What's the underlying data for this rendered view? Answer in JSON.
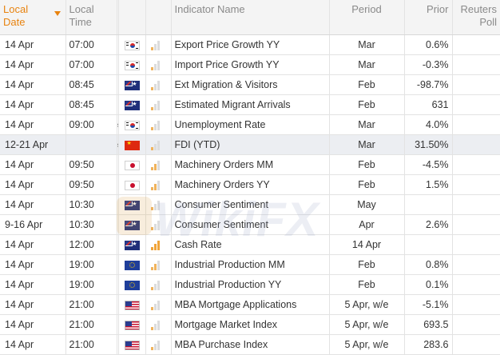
{
  "header": {
    "local_date": [
      "Local",
      "Date"
    ],
    "local_time": [
      "Local",
      "Time"
    ],
    "indicator_name": "Indicator Name",
    "period": "Period",
    "prior": "Prior",
    "reuters_poll": [
      "Reuters",
      "Poll"
    ]
  },
  "colors": {
    "sorted_header": "#e8830f",
    "importance_active": "#f0a43a",
    "highlight_row": "#eceef2"
  },
  "rows": [
    {
      "date": "14 Apr",
      "time": "07:00",
      "approx": "",
      "flag": "south-korea-flag",
      "importance": 1,
      "name": "Export Price Growth YY",
      "period": "Mar",
      "prior": "0.6%",
      "poll": "",
      "highlight": false
    },
    {
      "date": "14 Apr",
      "time": "07:00",
      "approx": "",
      "flag": "south-korea-flag",
      "importance": 1,
      "name": "Import Price Growth YY",
      "period": "Mar",
      "prior": "-0.3%",
      "poll": "",
      "highlight": false
    },
    {
      "date": "14 Apr",
      "time": "08:45",
      "approx": "",
      "flag": "new-zealand-flag",
      "importance": 1,
      "name": "Ext Migration & Visitors",
      "period": "Feb",
      "prior": "-98.7%",
      "poll": "",
      "highlight": false
    },
    {
      "date": "14 Apr",
      "time": "08:45",
      "approx": "",
      "flag": "new-zealand-flag",
      "importance": 1,
      "name": "Estimated Migrant Arrivals",
      "period": "Feb",
      "prior": "631",
      "poll": "",
      "highlight": false
    },
    {
      "date": "14 Apr",
      "time": "09:00",
      "approx": "≈",
      "flag": "south-korea-flag",
      "importance": 1,
      "name": "Unemployment Rate",
      "period": "Mar",
      "prior": "4.0%",
      "poll": "",
      "highlight": false
    },
    {
      "date": "12-21 Apr",
      "time": "",
      "approx": "≈",
      "flag": "china-flag",
      "importance": 1,
      "name": "FDI (YTD)",
      "period": "Mar",
      "prior": "31.50%",
      "poll": "",
      "highlight": true
    },
    {
      "date": "14 Apr",
      "time": "09:50",
      "approx": "",
      "flag": "japan-flag",
      "importance": 2,
      "name": "Machinery Orders MM",
      "period": "Feb",
      "prior": "-4.5%",
      "poll": "",
      "highlight": false
    },
    {
      "date": "14 Apr",
      "time": "09:50",
      "approx": "",
      "flag": "japan-flag",
      "importance": 2,
      "name": "Machinery Orders YY",
      "period": "Feb",
      "prior": "1.5%",
      "poll": "",
      "highlight": false
    },
    {
      "date": "14 Apr",
      "time": "10:30",
      "approx": "",
      "flag": "australia-flag",
      "importance": 1,
      "name": "Consumer Sentiment",
      "period": "May",
      "prior": "",
      "poll": "",
      "highlight": false
    },
    {
      "date": "9-16 Apr",
      "time": "10:30",
      "approx": "",
      "flag": "australia-flag",
      "importance": 1,
      "name": "Consumer Sentiment",
      "period": "Apr",
      "prior": "2.6%",
      "poll": "",
      "highlight": false
    },
    {
      "date": "14 Apr",
      "time": "12:00",
      "approx": "",
      "flag": "new-zealand-flag",
      "importance": 3,
      "name": "Cash Rate",
      "period": "14 Apr",
      "prior": "",
      "poll": "",
      "highlight": false
    },
    {
      "date": "14 Apr",
      "time": "19:00",
      "approx": "",
      "flag": "euro-flag",
      "importance": 2,
      "name": "Industrial Production MM",
      "period": "Feb",
      "prior": "0.8%",
      "poll": "",
      "highlight": false
    },
    {
      "date": "14 Apr",
      "time": "19:00",
      "approx": "",
      "flag": "euro-flag",
      "importance": 1,
      "name": "Industrial Production YY",
      "period": "Feb",
      "prior": "0.1%",
      "poll": "",
      "highlight": false
    },
    {
      "date": "14 Apr",
      "time": "21:00",
      "approx": "",
      "flag": "usa-flag",
      "importance": 1,
      "name": "MBA Mortgage Applications",
      "period": "5 Apr, w/e",
      "prior": "-5.1%",
      "poll": "",
      "highlight": false
    },
    {
      "date": "14 Apr",
      "time": "21:00",
      "approx": "",
      "flag": "usa-flag",
      "importance": 1,
      "name": "Mortgage Market Index",
      "period": "5 Apr, w/e",
      "prior": "693.5",
      "poll": "",
      "highlight": false
    },
    {
      "date": "14 Apr",
      "time": "21:00",
      "approx": "",
      "flag": "usa-flag",
      "importance": 1,
      "name": "MBA Purchase Index",
      "period": "5 Apr, w/e",
      "prior": "283.6",
      "poll": "",
      "highlight": false
    }
  ],
  "watermark": {
    "text": "WikiFX",
    "icon": "wikifx-logo-icon"
  }
}
